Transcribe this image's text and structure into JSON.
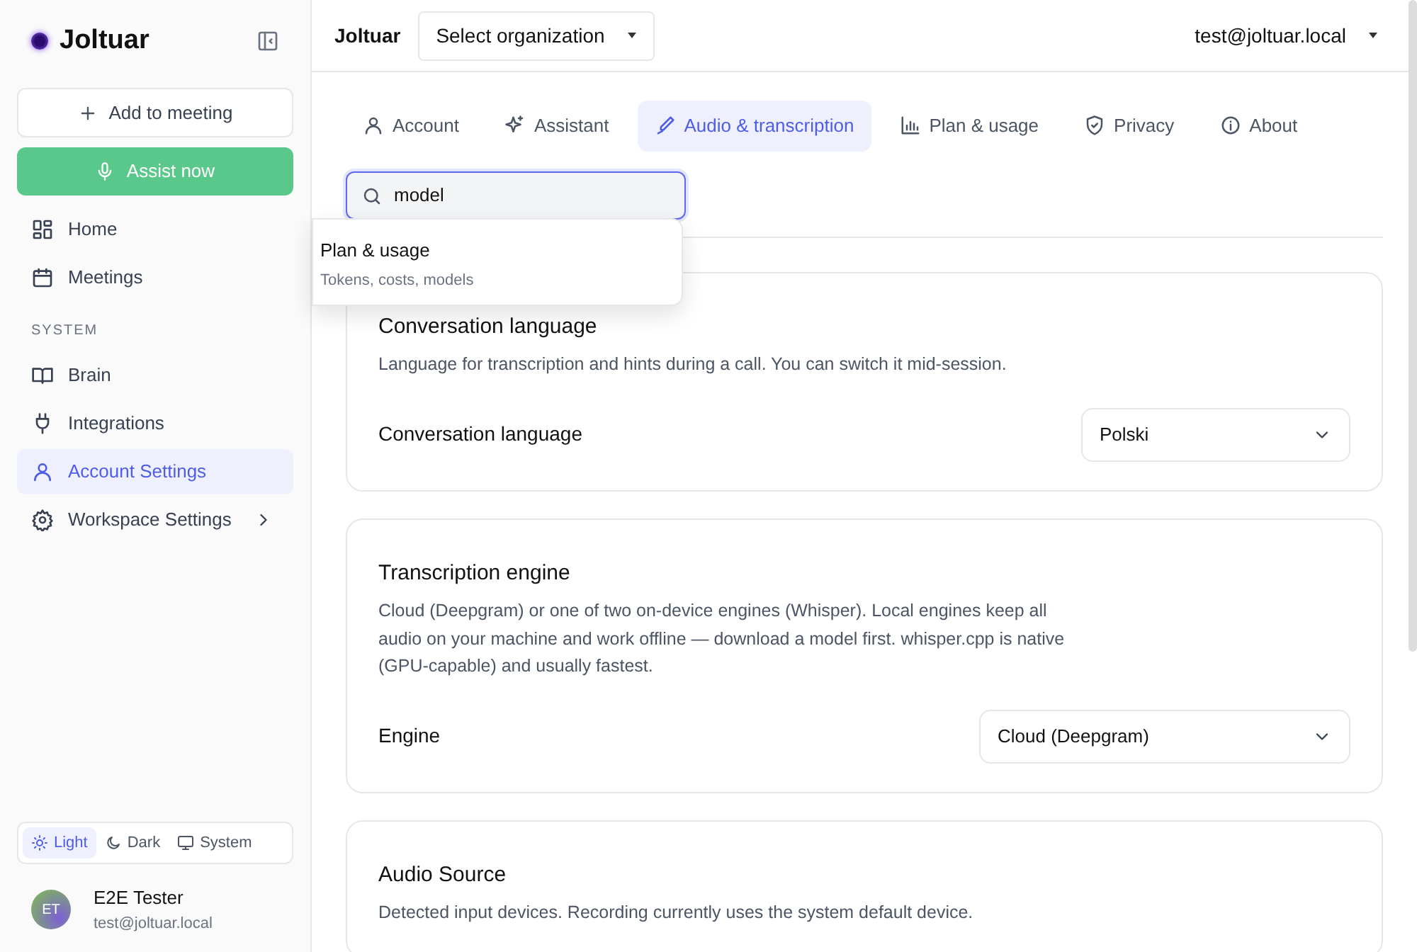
{
  "sidebar": {
    "brand": "Joltuar",
    "add_button": "Add to meeting",
    "assist_button": "Assist now",
    "nav": [
      {
        "label": "Home",
        "kind": "grid",
        "selected": false
      },
      {
        "label": "Meetings",
        "kind": "calendar",
        "selected": false
      }
    ],
    "section_title": "SYSTEM",
    "system_nav": [
      {
        "label": "Brain",
        "kind": "book",
        "selected": false,
        "expandable": false
      },
      {
        "label": "Integrations",
        "kind": "plug",
        "selected": false,
        "expandable": false
      },
      {
        "label": "Account Settings",
        "kind": "user",
        "selected": true,
        "expandable": false
      },
      {
        "label": "Workspace Settings",
        "kind": "gear",
        "selected": false,
        "expandable": true
      }
    ],
    "theme_options": [
      {
        "label": "Light",
        "kind": "sun",
        "selected": true
      },
      {
        "label": "Dark",
        "kind": "moon",
        "selected": false
      },
      {
        "label": "System",
        "kind": "monitor",
        "selected": false
      }
    ],
    "user": {
      "initials": "ET",
      "name": "E2E Tester",
      "email": "test@joltuar.local"
    }
  },
  "topbar": {
    "brand": "Joltuar",
    "org_select": "Select organization",
    "account": "test@joltuar.local"
  },
  "tabs": [
    {
      "label": "Account",
      "kind": "user",
      "selected": false
    },
    {
      "label": "Assistant",
      "kind": "sparkle",
      "selected": false
    },
    {
      "label": "Audio & transcription",
      "kind": "pen",
      "selected": true
    },
    {
      "label": "Plan & usage",
      "kind": "chart",
      "selected": false
    },
    {
      "label": "Privacy",
      "kind": "shield",
      "selected": false
    },
    {
      "label": "About",
      "kind": "info",
      "selected": false
    }
  ],
  "search": {
    "value": "model",
    "results": [
      {
        "title": "Plan & usage",
        "subtitle": "Tokens, costs, models"
      }
    ]
  },
  "sections": [
    {
      "title": "Conversation language",
      "description": "Language for transcription and hints during a call. You can switch it mid-session.",
      "field_label": "Conversation language",
      "field_value": "Polski"
    },
    {
      "title": "Transcription engine",
      "description": "Cloud (Deepgram) or one of two on-device engines (Whisper). Local engines keep all audio on your machine and work offline — download a model first. whisper.cpp is native (GPU-capable) and usually fastest.",
      "field_label": "Engine",
      "field_value": "Cloud (Deepgram)"
    },
    {
      "title": "Audio Source",
      "description": "Detected input devices. Recording currently uses the system default device."
    }
  ]
}
